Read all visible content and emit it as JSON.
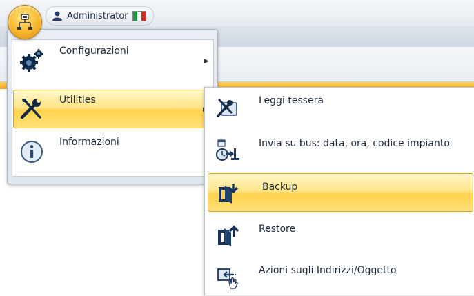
{
  "titlebar": {
    "user": "Administrator",
    "flag_colors": [
      "#1a9c3e",
      "#ffffff",
      "#d52b1e"
    ]
  },
  "main_menu": {
    "items": [
      {
        "label": "Configurazioni",
        "icon": "gears-icon",
        "has_submenu": true
      },
      {
        "label": "Utilities",
        "icon": "tools-icon",
        "has_submenu": true,
        "selected": true
      },
      {
        "label": "Informazioni",
        "icon": "info-icon",
        "has_submenu": false
      }
    ],
    "arrow_glyph": "▶"
  },
  "submenu": {
    "items": [
      {
        "label": "Leggi tessera",
        "icon": "read-card-icon"
      },
      {
        "label": "Invia su bus: data, ora, codice impianto",
        "icon": "send-datetime-icon"
      },
      {
        "label": "Backup",
        "icon": "backup-icon",
        "selected": true
      },
      {
        "label": "Restore",
        "icon": "restore-icon"
      },
      {
        "label": "Azioni sugli Indirizzi/Oggetto",
        "icon": "address-actions-icon"
      }
    ]
  },
  "colors": {
    "highlight": "#ffd24d",
    "highlight_border": "#d9a51c",
    "orb": "#f6b62c"
  }
}
